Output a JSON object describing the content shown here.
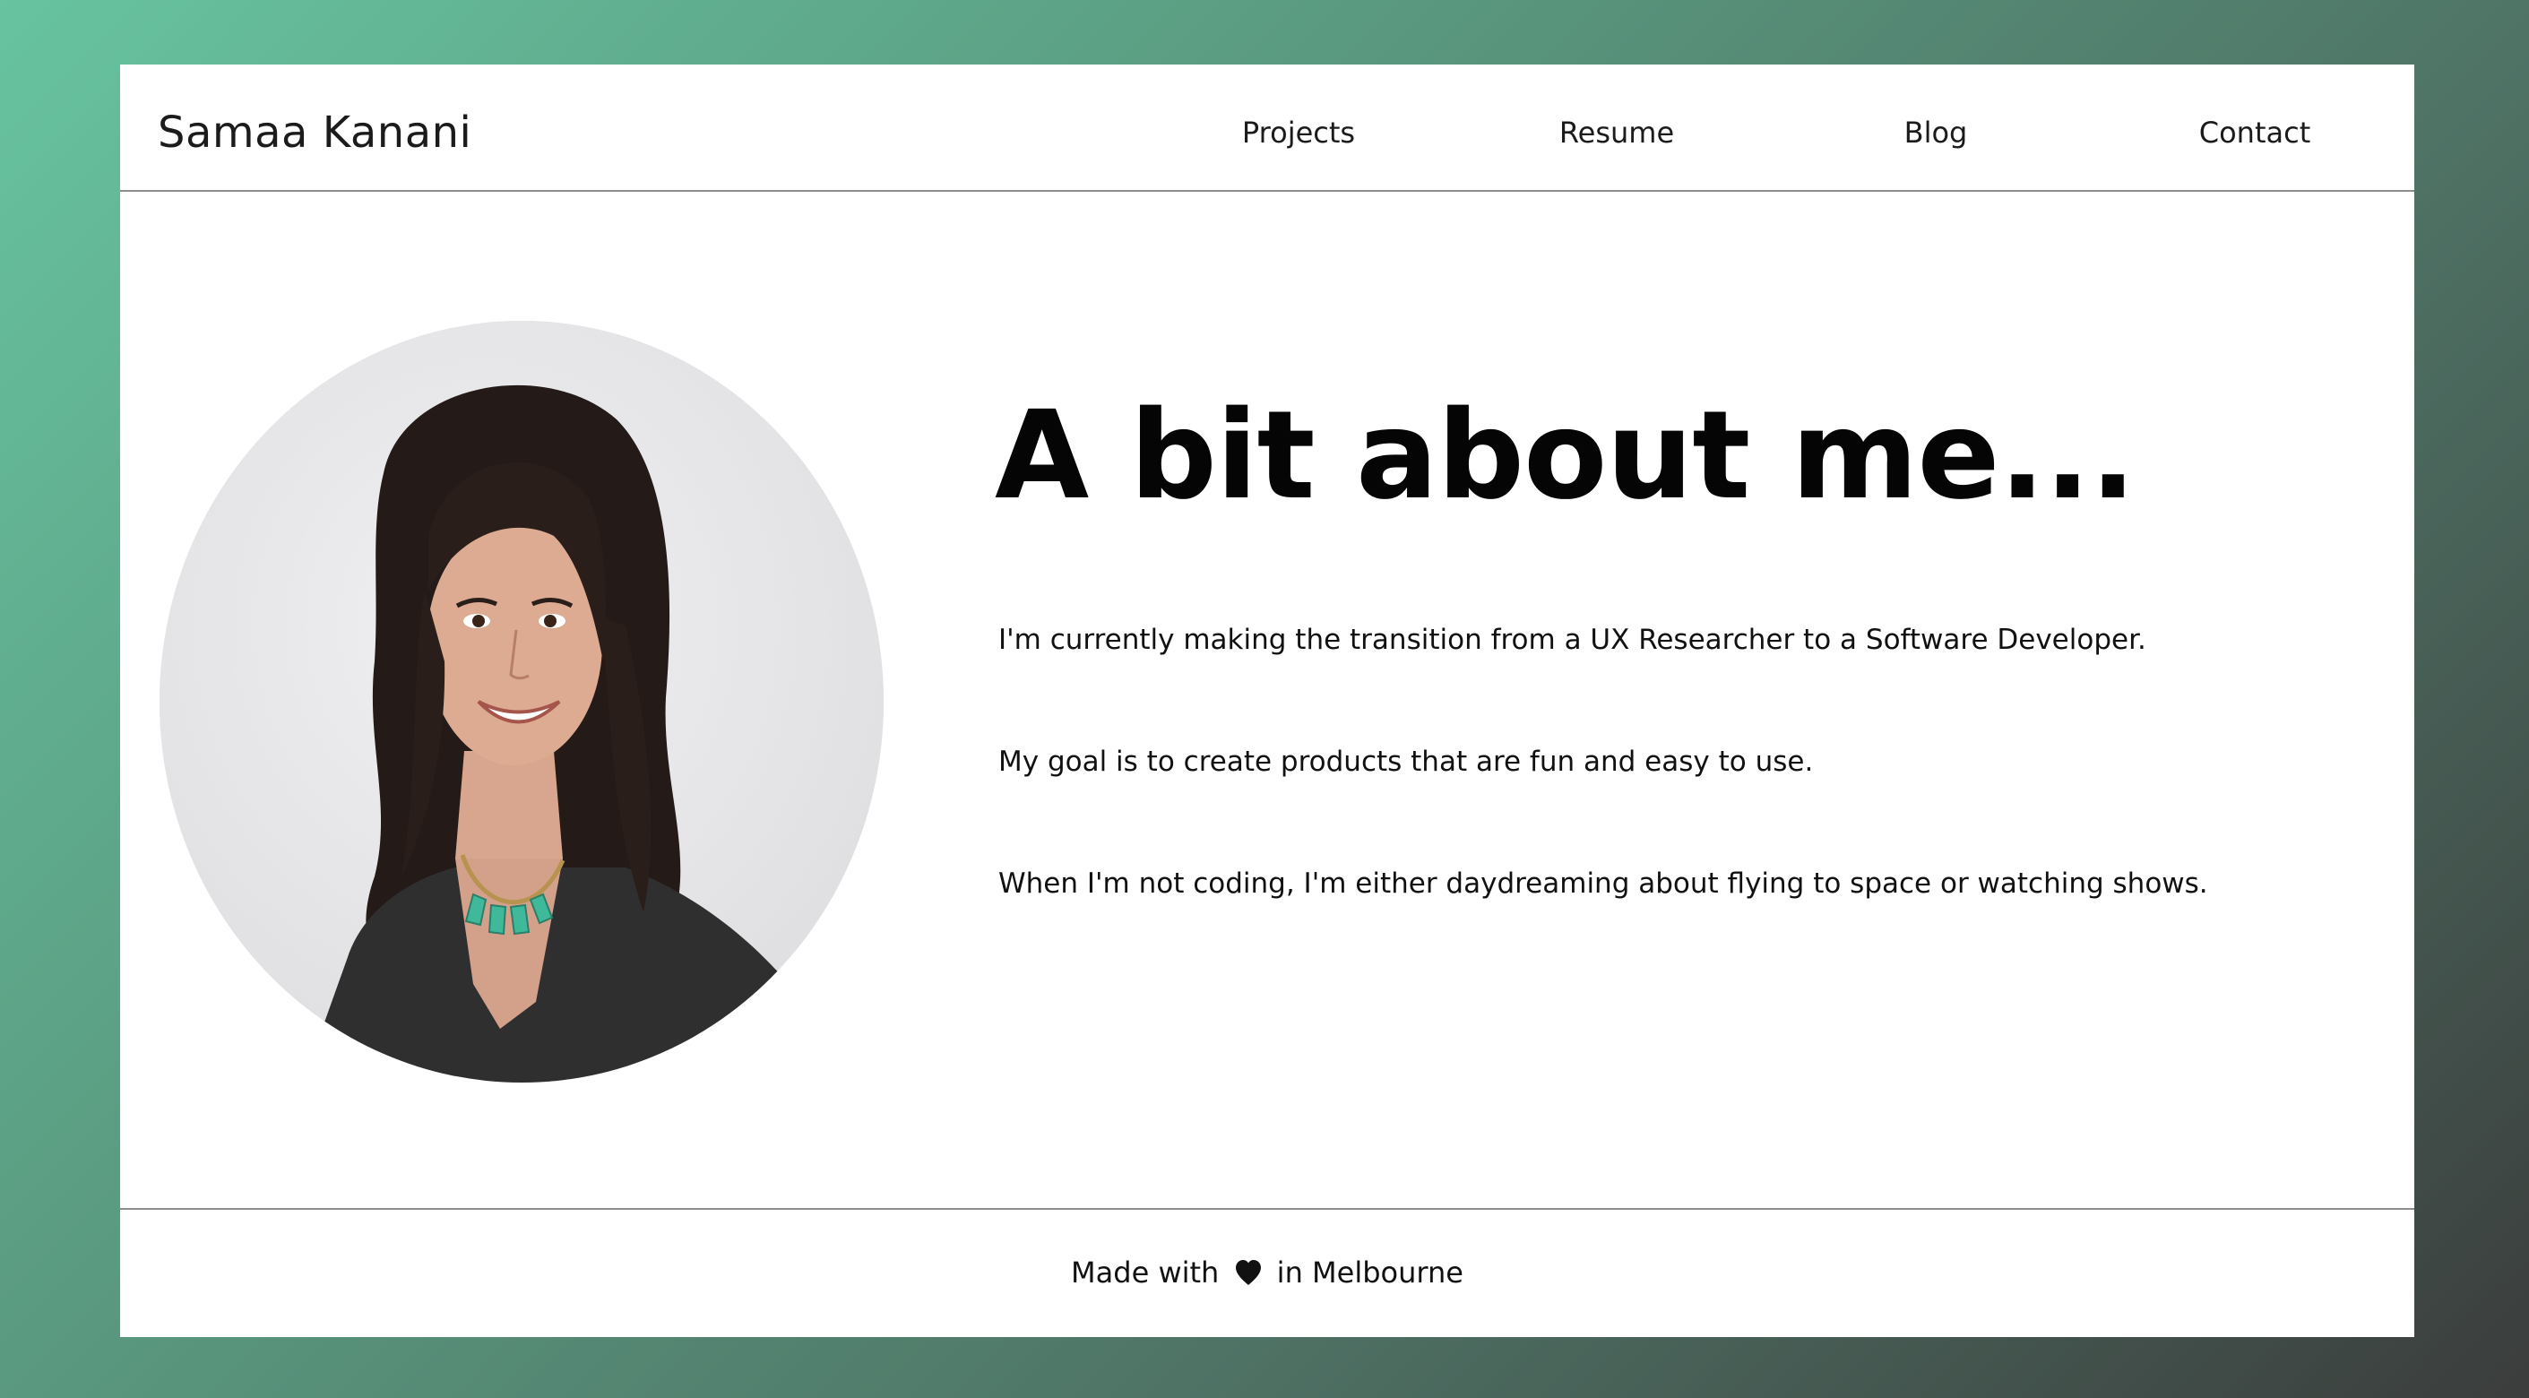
{
  "header": {
    "site_name": "Samaa Kanani",
    "nav": [
      {
        "label": "Projects"
      },
      {
        "label": "Resume"
      },
      {
        "label": "Blog"
      },
      {
        "label": "Contact"
      }
    ]
  },
  "about": {
    "heading": "A bit about me...",
    "paragraphs": [
      "I'm currently making the transition from a UX Researcher to a Software Developer.",
      "My goal is to create products that are fun and easy to use.",
      "When I'm not coding, I'm either daydreaming about flying to space or watching shows."
    ],
    "photo_icon": "portrait-photo"
  },
  "footer": {
    "prefix": "Made with",
    "icon": "heart-icon",
    "suffix": "in Melbourne"
  },
  "colors": {
    "background_gradient_start": "#67c3a0",
    "background_gradient_end": "#3b3d3c",
    "card": "#ffffff",
    "divider": "#8d8d8d",
    "text": "#111111"
  }
}
